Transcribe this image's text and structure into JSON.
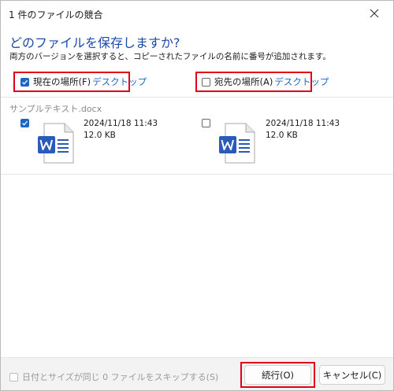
{
  "window": {
    "title": "1 件のファイルの競合"
  },
  "heading": "どのファイルを保存しますか?",
  "description": "両方のバージョンを選択すると、コピーされたファイルの名前に番号が追加されます。",
  "source": {
    "label": "現在の場所(F)",
    "location": "デスクトップ",
    "checked": true
  },
  "destination": {
    "label": "宛先の場所(A)",
    "location": "デスクトップ",
    "checked": false
  },
  "file": {
    "name": "サンプルテキスト.docx",
    "left": {
      "date": "2024/11/18 11:43",
      "size": "12.0 KB",
      "checked": true
    },
    "right": {
      "date": "2024/11/18 11:43",
      "size": "12.0 KB",
      "checked": false
    },
    "icon": "word-document-icon"
  },
  "footer": {
    "skip_label": "日付とサイズが同じ 0 ファイルをスキップする(S)",
    "continue_label": "続行(O)",
    "cancel_label": "キャンセル(C)"
  },
  "colors": {
    "accent": "#1a66c9",
    "heading": "#1a4aa8",
    "highlight": "#e0001b",
    "word_blue": "#2b5bb8"
  }
}
